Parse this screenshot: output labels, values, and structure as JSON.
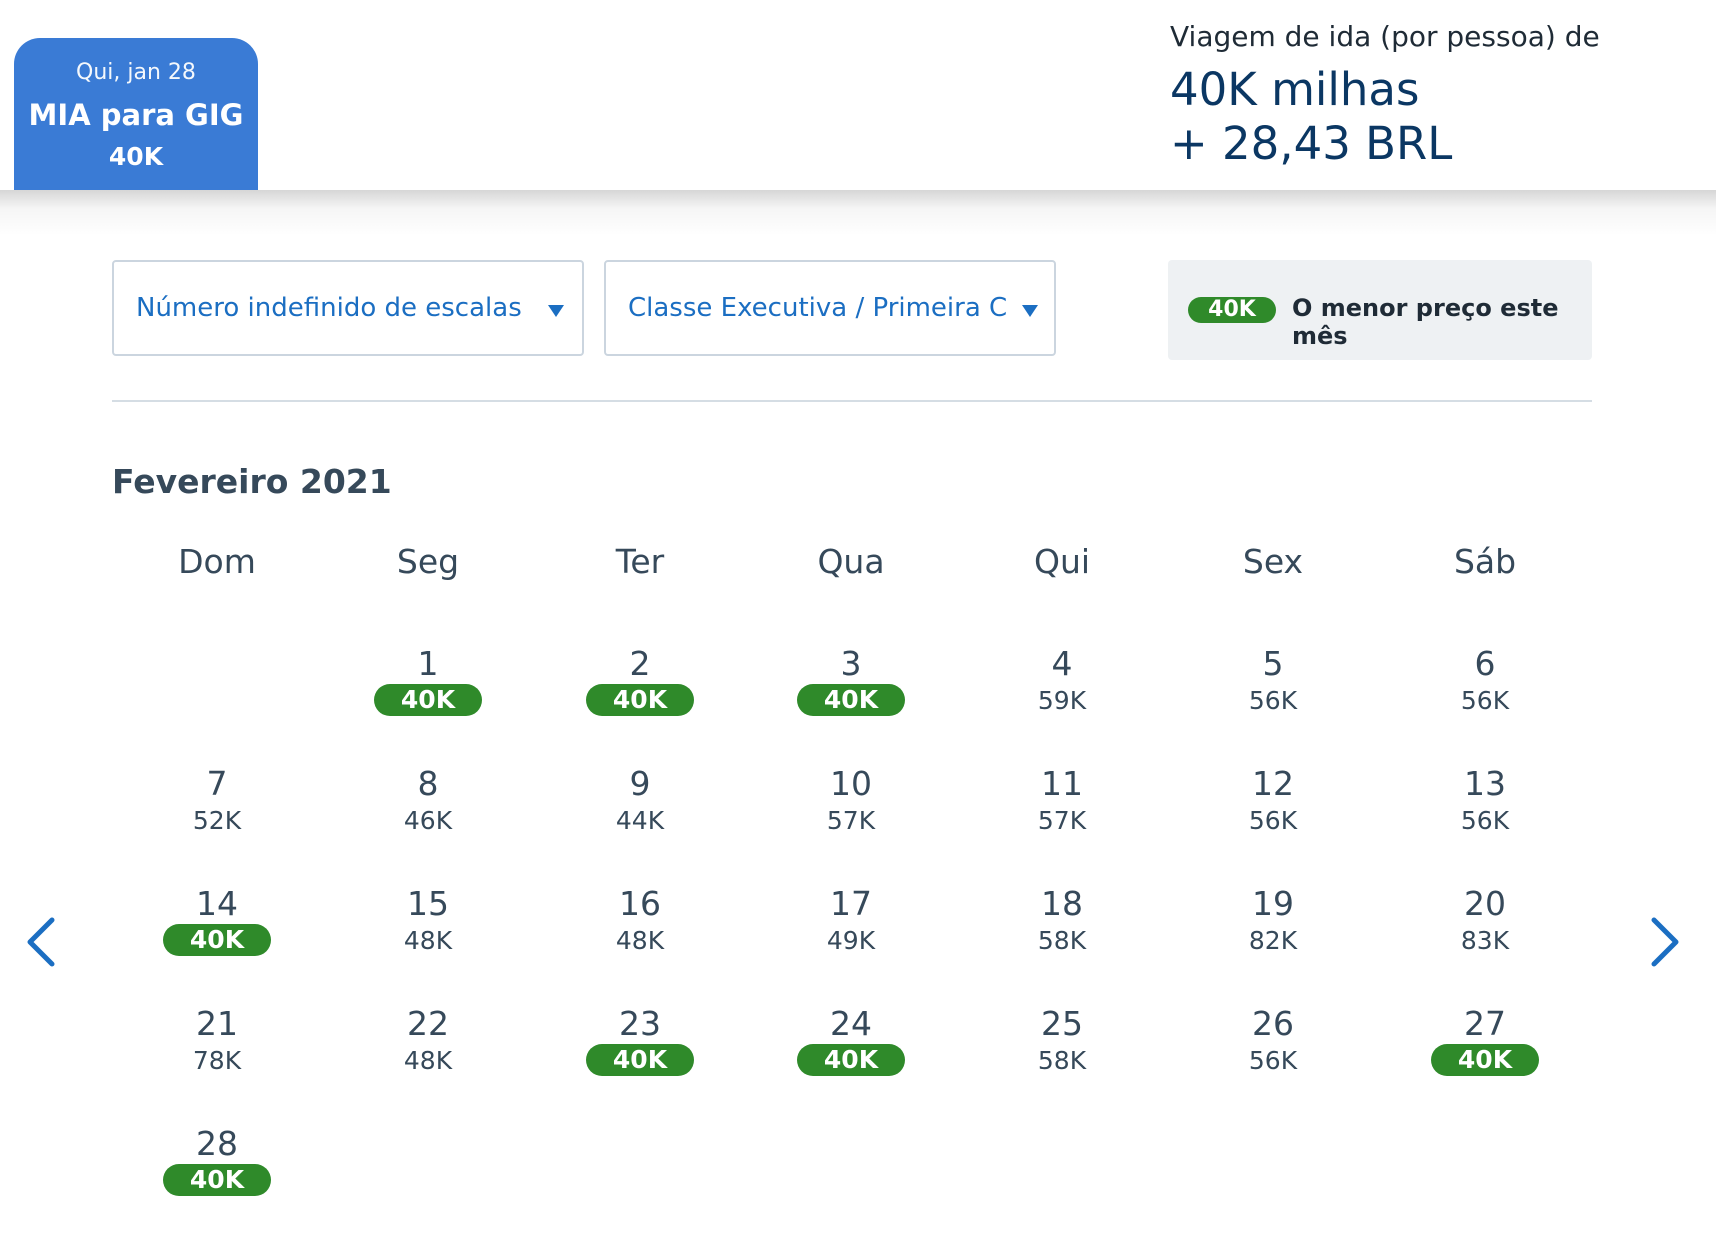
{
  "header": {
    "selected_tab": {
      "date": "Qui, jan 28",
      "route": "MIA para GIG",
      "price": "40K"
    },
    "summary": {
      "label": "Viagem de ida (por pessoa) de",
      "miles": "40K milhas",
      "cash": "+ 28,43 BRL"
    }
  },
  "filters": {
    "stops": "Número indefinido de escalas",
    "cabin": "Classe Executiva / Primeira Classe"
  },
  "legend": {
    "badge": "40K",
    "text": "O menor preço este mês"
  },
  "calendar": {
    "month": "Fevereiro 2021",
    "weekdays": [
      "Dom",
      "Seg",
      "Ter",
      "Qua",
      "Qui",
      "Sex",
      "Sáb"
    ],
    "days": [
      {
        "day": "1",
        "price": "40K",
        "lowest": true
      },
      {
        "day": "2",
        "price": "40K",
        "lowest": true
      },
      {
        "day": "3",
        "price": "40K",
        "lowest": true
      },
      {
        "day": "4",
        "price": "59K",
        "lowest": false
      },
      {
        "day": "5",
        "price": "56K",
        "lowest": false
      },
      {
        "day": "6",
        "price": "56K",
        "lowest": false
      },
      {
        "day": "7",
        "price": "52K",
        "lowest": false
      },
      {
        "day": "8",
        "price": "46K",
        "lowest": false
      },
      {
        "day": "9",
        "price": "44K",
        "lowest": false
      },
      {
        "day": "10",
        "price": "57K",
        "lowest": false
      },
      {
        "day": "11",
        "price": "57K",
        "lowest": false
      },
      {
        "day": "12",
        "price": "56K",
        "lowest": false
      },
      {
        "day": "13",
        "price": "56K",
        "lowest": false
      },
      {
        "day": "14",
        "price": "40K",
        "lowest": true
      },
      {
        "day": "15",
        "price": "48K",
        "lowest": false
      },
      {
        "day": "16",
        "price": "48K",
        "lowest": false
      },
      {
        "day": "17",
        "price": "49K",
        "lowest": false
      },
      {
        "day": "18",
        "price": "58K",
        "lowest": false
      },
      {
        "day": "19",
        "price": "82K",
        "lowest": false
      },
      {
        "day": "20",
        "price": "83K",
        "lowest": false
      },
      {
        "day": "21",
        "price": "78K",
        "lowest": false
      },
      {
        "day": "22",
        "price": "48K",
        "lowest": false
      },
      {
        "day": "23",
        "price": "40K",
        "lowest": true
      },
      {
        "day": "24",
        "price": "40K",
        "lowest": true
      },
      {
        "day": "25",
        "price": "58K",
        "lowest": false
      },
      {
        "day": "26",
        "price": "56K",
        "lowest": false
      },
      {
        "day": "27",
        "price": "40K",
        "lowest": true
      },
      {
        "day": "28",
        "price": "40K",
        "lowest": true
      }
    ]
  },
  "nav": {
    "prev_icon": "chevron-left-icon",
    "next_icon": "chevron-right-icon"
  },
  "colors": {
    "accent_blue": "#3a7bd5",
    "link_blue": "#1b6ec2",
    "lowest_green": "#2f8a2a",
    "text": "#36495a"
  }
}
